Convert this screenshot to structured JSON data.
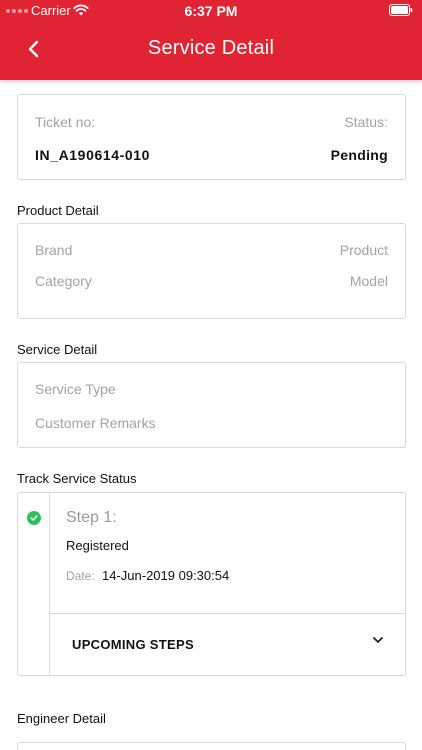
{
  "status_bar": {
    "carrier": "Carrier",
    "time": "6:37 PM"
  },
  "header": {
    "title": "Service Detail"
  },
  "ticket": {
    "ticket_label": "Ticket no:",
    "status_label": "Status:",
    "ticket_no": "IN_A190614-010",
    "status": "Pending"
  },
  "product": {
    "section_title": "Product Detail",
    "brand_label": "Brand",
    "product_label": "Product",
    "category_label": "Category",
    "model_label": "Model"
  },
  "service": {
    "section_title": "Service Detail",
    "type_label": "Service Type",
    "remarks_label": "Customer Remarks"
  },
  "track": {
    "section_title": "Track Service Status",
    "step_label": "Step 1:",
    "step_name": "Registered",
    "date_label": "Date:",
    "date_value": "14-Jun-2019 09:30:54",
    "upcoming_label": "UPCOMING STEPS"
  },
  "engineer": {
    "section_title": "Engineer Detail"
  },
  "colors": {
    "brand": "#e02433",
    "success": "#2fc25b",
    "muted": "#a3a3a3",
    "border": "#d9d9d9"
  }
}
